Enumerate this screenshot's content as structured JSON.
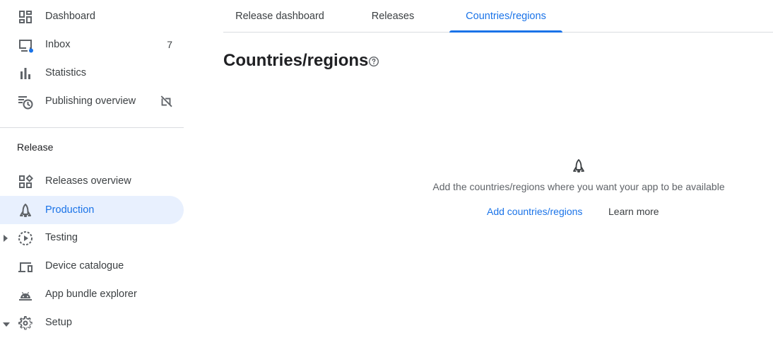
{
  "sidebar": {
    "items": [
      {
        "label": "Dashboard",
        "icon": "dashboard-icon"
      },
      {
        "label": "Inbox",
        "icon": "inbox-icon",
        "count": "7"
      },
      {
        "label": "Statistics",
        "icon": "bar-chart-icon"
      },
      {
        "label": "Publishing overview",
        "icon": "publishing-icon",
        "trail_icon": "sync-disabled-icon"
      }
    ],
    "section_title": "Release",
    "release_items": [
      {
        "label": "Releases overview",
        "icon": "widgets-icon"
      },
      {
        "label": "Production",
        "icon": "rocket-icon",
        "active": true
      },
      {
        "label": "Testing",
        "icon": "play-circle-icon",
        "expandable": "collapsed"
      },
      {
        "label": "Device catalogue",
        "icon": "devices-icon"
      },
      {
        "label": "App bundle explorer",
        "icon": "android-icon"
      },
      {
        "label": "Setup",
        "icon": "gear-icon",
        "expandable": "expanded"
      }
    ]
  },
  "tabs": [
    {
      "label": "Release dashboard"
    },
    {
      "label": "Releases"
    },
    {
      "label": "Countries/regions",
      "active": true
    }
  ],
  "main": {
    "title": "Countries/regions",
    "empty_state": {
      "icon": "rocket-icon",
      "text": "Add the countries/regions where you want your app to be available",
      "primary_link": "Add countries/regions",
      "secondary_link": "Learn more"
    }
  },
  "colors": {
    "accent": "#1a73e8",
    "active_bg": "#e8f0fe",
    "text": "#3c4043",
    "muted_text": "#5f6368",
    "divider": "#dadce0",
    "notification_dot": "#1a73e8"
  }
}
